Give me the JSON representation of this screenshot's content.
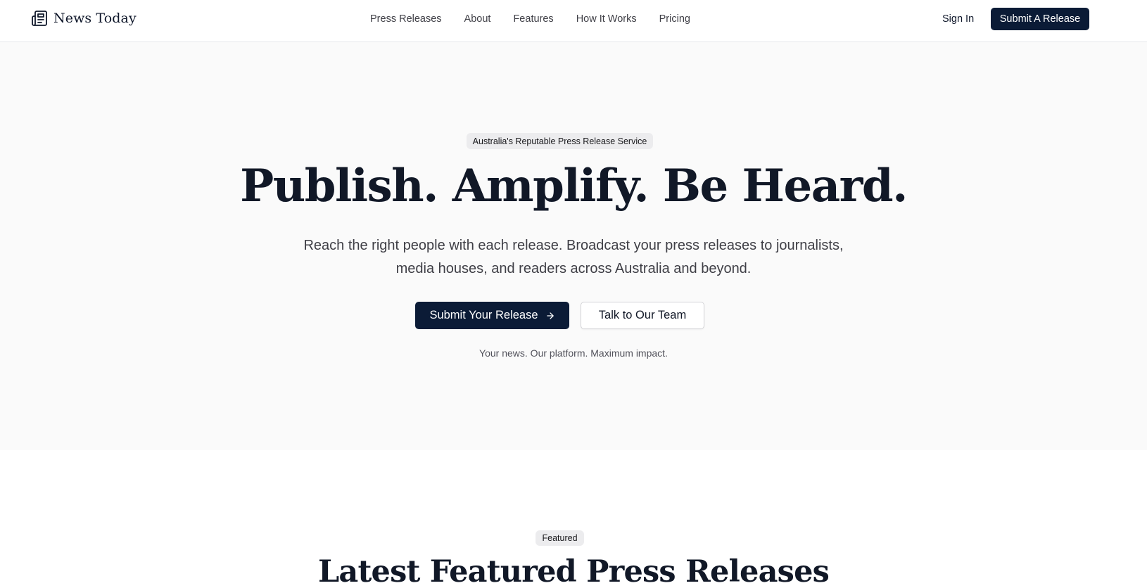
{
  "brand": {
    "name": "News Today",
    "icon": "newspaper-icon"
  },
  "nav": {
    "items": [
      {
        "label": "Press Releases"
      },
      {
        "label": "About"
      },
      {
        "label": "Features"
      },
      {
        "label": "How It Works"
      },
      {
        "label": "Pricing"
      }
    ],
    "sign_in": "Sign In",
    "submit_release": "Submit A Release"
  },
  "hero": {
    "badge": "Australia's Reputable Press Release Service",
    "title": "Publish. Amplify. Be Heard.",
    "subtitle": "Reach the right people with each release. Broadcast your press releases to journalists, media houses, and readers across Australia and beyond.",
    "primary_cta": "Submit Your Release",
    "primary_cta_icon": "arrow-right-icon",
    "secondary_cta": "Talk to Our Team",
    "tagline": "Your news. Our platform. Maximum impact."
  },
  "featured": {
    "badge": "Featured",
    "title": "Latest Featured Press Releases"
  },
  "colors": {
    "primary": "#0b1b36",
    "hero_background": "#fafafa",
    "badge_background": "#ececee",
    "text_dark": "#111827",
    "text_muted": "#3f3f46"
  }
}
